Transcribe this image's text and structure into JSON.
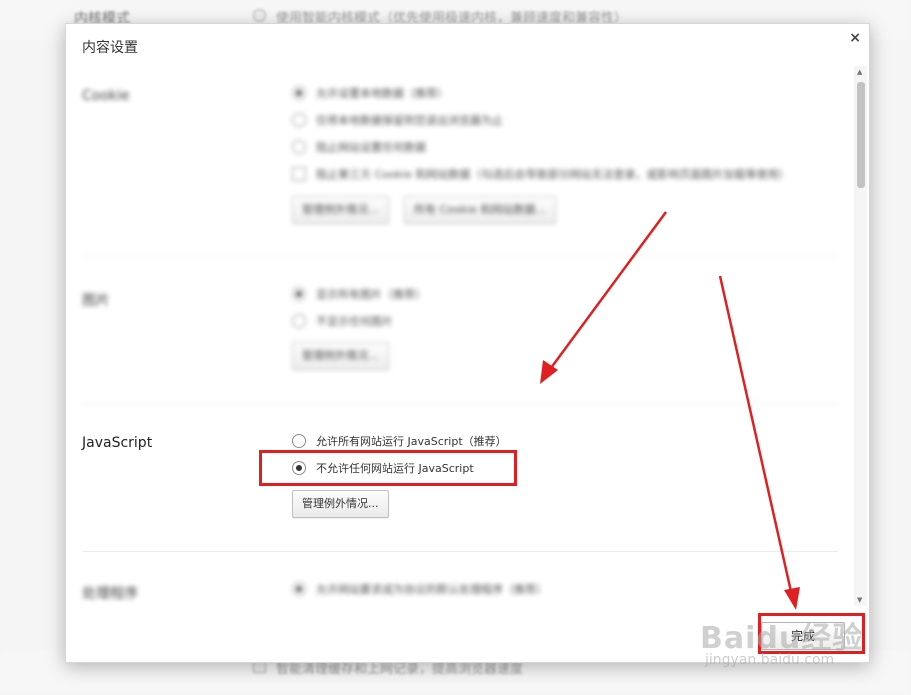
{
  "background": {
    "kernel_label": "内核模式",
    "kernel_option": "使用智能内核模式（优先使用极速内核，兼顾速度和兼容性）",
    "bottom_option": "智能清理缓存和上网记录，提高浏览器速度"
  },
  "dialog": {
    "title": "内容设置",
    "close_icon": "×",
    "done_label": "完成"
  },
  "sections": {
    "cookie": {
      "label": "Cookie",
      "options": [
        "允许设置本地数据（推荐）",
        "仅将本地数据保留到您退出浏览器为止",
        "阻止网站设置任何数据",
        "阻止第三方 Cookie 和网站数据（勾选后会导致部分网站无法登录，或影响页面图片加载等使用）"
      ],
      "button_exceptions": "管理例外情况...",
      "button_all": "所有 Cookie 和网站数据..."
    },
    "images": {
      "label": "图片",
      "options": [
        "显示所有图片（推荐）",
        "不显示任何图片"
      ],
      "button_exceptions": "管理例外情况..."
    },
    "javascript": {
      "label": "JavaScript",
      "option_allow": "允许所有网站运行 JavaScript（推荐）",
      "option_block": "不允许任何网站运行 JavaScript",
      "button_exceptions": "管理例外情况..."
    },
    "handlers": {
      "label": "处理程序",
      "option": "允许网站要求成为协议的默认处理程序（推荐）"
    }
  },
  "watermark": {
    "brand": "Baidu经验",
    "url": "jingyan.baidu.com"
  },
  "colors": {
    "annotation": "#e02020"
  }
}
